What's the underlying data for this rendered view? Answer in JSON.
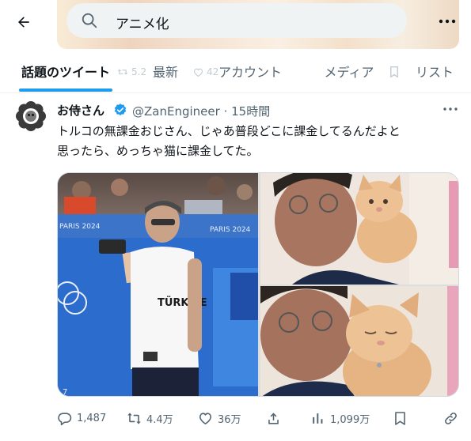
{
  "search": {
    "query": "アニメ化"
  },
  "tabs": [
    {
      "label": "話題のツイート",
      "active": true
    },
    {
      "label": "最新",
      "active": false
    },
    {
      "label": "アカウント",
      "active": false
    },
    {
      "label": "メディア",
      "active": false
    },
    {
      "label": "リスト",
      "active": false
    }
  ],
  "ghost_counts": {
    "retweet": "5.2",
    "like": "42"
  },
  "tweet": {
    "display_name": "お侍さん",
    "handle": "@ZanEngineer",
    "separator": "·",
    "time": "15時間",
    "text_line1": "トルコの無課金おじさん、じゃあ普段どこに課金してるんだよと",
    "text_line2": "思ったら、めっちゃ猫に課金してた。",
    "photo_texts": {
      "shirt": "TÜRKIYE",
      "paris_banner": "PARIS 2024",
      "corner": "7"
    },
    "actions": {
      "reply": "1,487",
      "retweet": "4.4万",
      "like": "36万",
      "views": "1,099万"
    }
  },
  "colors": {
    "accent": "#1d9bf0",
    "muted": "#536471",
    "text": "#0f1419",
    "search_bg": "#eff3f4"
  },
  "icons": [
    "back-arrow-icon",
    "search-icon",
    "more-icon",
    "verified-icon",
    "reply-icon",
    "retweet-icon",
    "like-icon",
    "share-icon",
    "views-icon",
    "bookmark-icon",
    "copy-link-icon"
  ]
}
